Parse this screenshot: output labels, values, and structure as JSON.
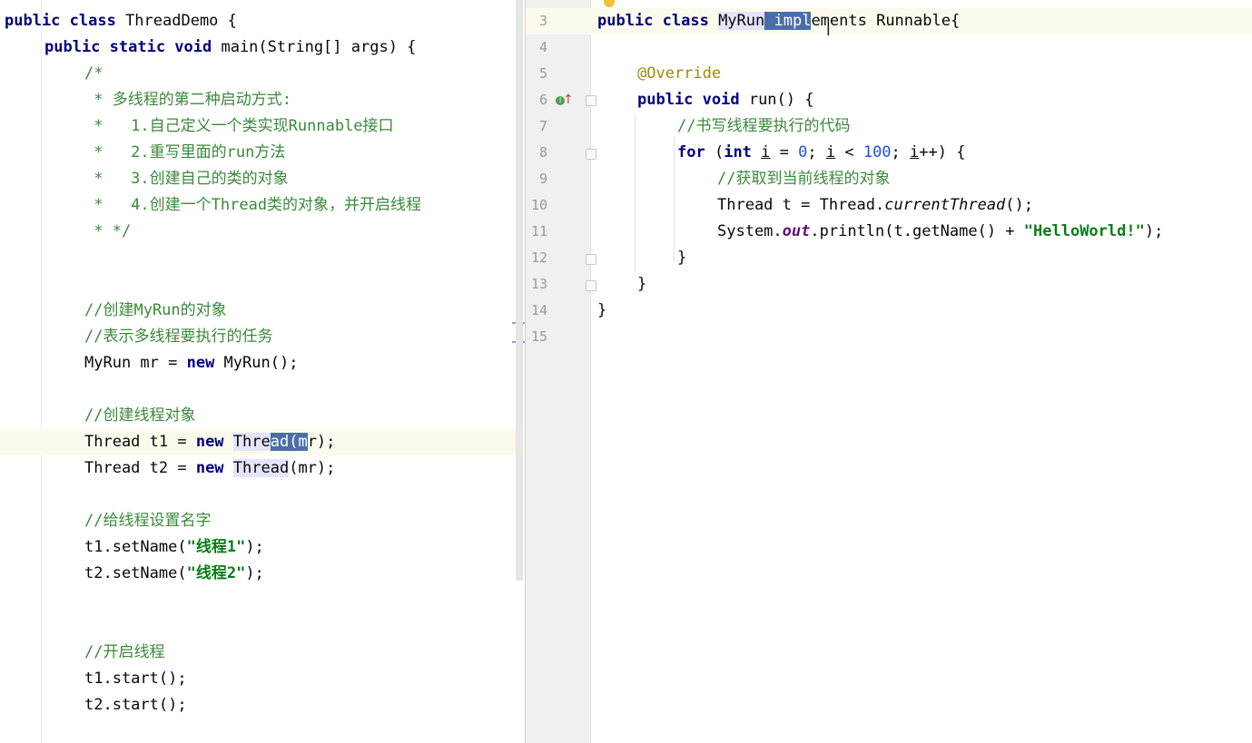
{
  "left_editor": {
    "lines": [
      [
        "public class ThreadDemo {"
      ],
      [
        "    public static void main(String[] args) {"
      ],
      [
        "        /*"
      ],
      [
        "         * 多线程的第二种启动方式:"
      ],
      [
        "         *   1.自己定义一个类实现Runnable接口"
      ],
      [
        "         *   2.重写里面的run方法"
      ],
      [
        "         *   3.创建自己的类的对象"
      ],
      [
        "         *   4.创建一个Thread类的对象，并开启线程"
      ],
      [
        "         * */"
      ],
      [
        ""
      ],
      [
        ""
      ],
      [
        "        //创建MyRun的对象"
      ],
      [
        "        //表示多线程要执行的任务"
      ],
      [
        "        MyRun mr = new MyRun();"
      ],
      [
        ""
      ],
      [
        "        //创建线程对象"
      ],
      [
        "        Thread t1 = new Thread(mr);"
      ],
      [
        "        Thread t2 = new Thread(mr);"
      ],
      [
        ""
      ],
      [
        "        //给线程设置名字"
      ],
      [
        "        t1.setName(\"线程1\");"
      ],
      [
        "        t2.setName(\"线程2\");"
      ],
      [
        ""
      ],
      [
        ""
      ],
      [
        "        //开启线程"
      ],
      [
        "        t1.start();"
      ],
      [
        "        t2.start();"
      ]
    ]
  },
  "right_editor": {
    "line_numbers": [
      "3",
      "4",
      "5",
      "6",
      "7",
      "8",
      "9",
      "10",
      "11",
      "12",
      "13",
      "14",
      "15"
    ],
    "lines": [
      "public class MyRun implements Runnable{",
      "",
      "    @Override",
      "    public void run() {",
      "        //书写线程要执行的代码",
      "        for (int i = 0; i < 100; i++) {",
      "            //获取到当前线程的对象",
      "            Thread t = Thread.currentThread();",
      "            System.out.println(t.getName() + \"HelloWorld!\");",
      "        }",
      "    }",
      "}",
      ""
    ]
  },
  "colors": {
    "keyword": "#000080",
    "comment": "#3a8a3a",
    "string": "#067d17",
    "number": "#1750eb",
    "annotation": "#9e880d",
    "selection": "#4a6ea9",
    "current_line": "#fcfaed"
  },
  "icons": [
    "run-gutter-icon",
    "override-arrow-icon",
    "intention-bulb-icon",
    "text-cursor-icon",
    "fold-marker-icon"
  ]
}
